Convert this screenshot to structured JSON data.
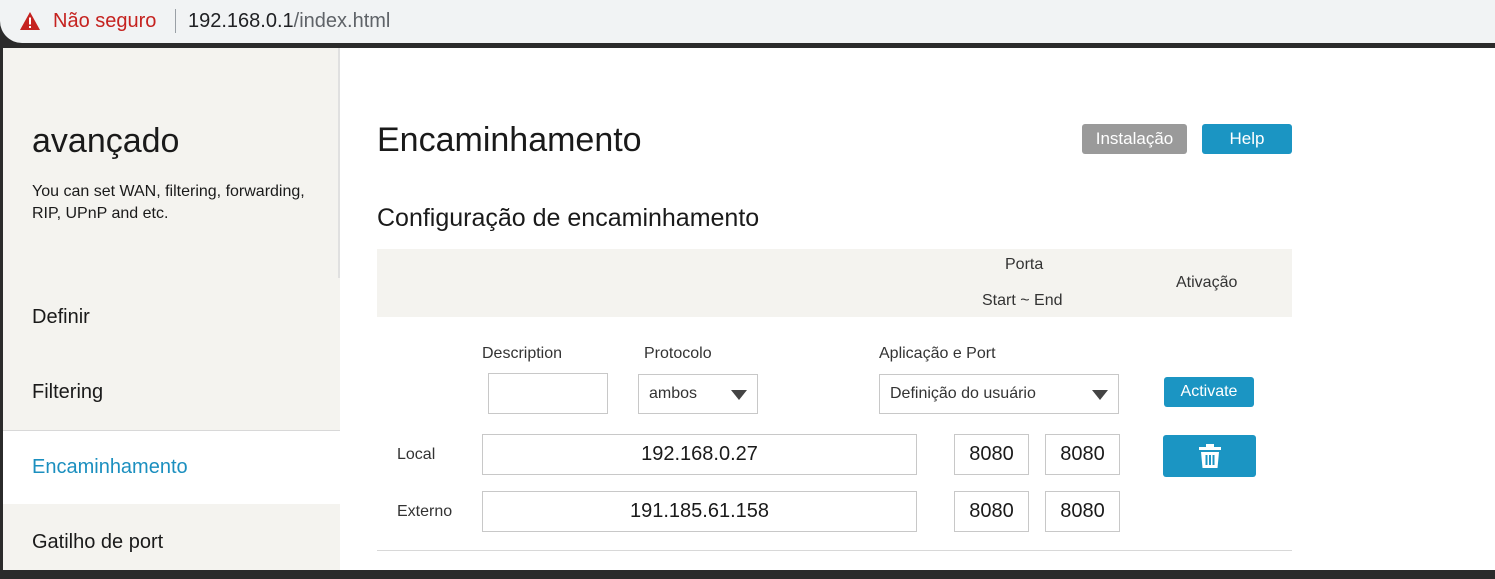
{
  "browser": {
    "security_label": "Não seguro",
    "url_host": "192.168.0.1",
    "url_path": "/index.html"
  },
  "sidebar": {
    "title": "avançado",
    "description": "You can set WAN, filtering, forwarding, RIP, UPnP and etc.",
    "items": [
      {
        "label": "Definir"
      },
      {
        "label": "Filtering"
      },
      {
        "label": "Encaminhamento"
      },
      {
        "label": "Gatilho de port"
      }
    ]
  },
  "header": {
    "title": "Encaminhamento",
    "install_label": "Instalação",
    "help_label": "Help"
  },
  "section": {
    "title": "Configuração de encaminhamento"
  },
  "table": {
    "port_header": "Porta",
    "start_end_header": "Start ~ End",
    "activation_header": "Ativação"
  },
  "form": {
    "description_label": "Description",
    "description_value": "",
    "protocol_label": "Protocolo",
    "protocol_value": "ambos",
    "application_label": "Aplicação e Port",
    "application_value": "Definição do usuário",
    "activate_label": "Activate"
  },
  "rows": [
    {
      "label": "Local",
      "ip": "192.168.0.27",
      "port_start": "8080",
      "port_end": "8080"
    },
    {
      "label": "Externo",
      "ip": "191.185.61.158",
      "port_start": "8080",
      "port_end": "8080"
    }
  ],
  "colors": {
    "accent": "#1b95c3",
    "active_nav": "#1b8fbf",
    "warning": "#c5221f",
    "sidebar_bg": "#f4f3ef"
  },
  "icons": {
    "security": "warning-triangle-icon",
    "delete": "trash-icon",
    "dropdown": "caret-down-icon"
  }
}
